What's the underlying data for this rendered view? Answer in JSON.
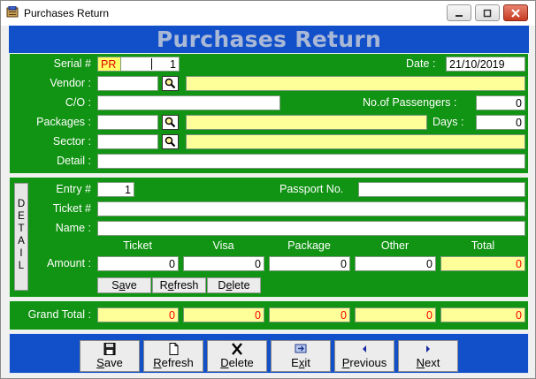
{
  "window": {
    "title": "Purchases Return"
  },
  "header": {
    "title": "Purchases Return"
  },
  "form": {
    "serial_label": "Serial #",
    "serial_prefix": "PR",
    "serial_number": "1",
    "date_label": "Date :",
    "date_value": "21/10/2019",
    "vendor_label": "Vendor :",
    "co_label": "C/O :",
    "passengers_label": "No.of Passengers :",
    "passengers_value": "0",
    "packages_label": "Packages :",
    "days_label": "Days :",
    "days_value": "0",
    "sector_label": "Sector :",
    "detail_label": "Detail :"
  },
  "detail": {
    "tab_letters": [
      "D",
      "E",
      "T",
      "A",
      "I",
      "L"
    ],
    "entry_label": "Entry #",
    "entry_value": "1",
    "passport_label": "Passport No.",
    "ticket_label": "Ticket #",
    "name_label": "Name :",
    "amount_label": "Amount :",
    "columns": [
      "Ticket",
      "Visa",
      "Package",
      "Other",
      "Total"
    ],
    "amounts": [
      "0",
      "0",
      "0",
      "0",
      "0"
    ],
    "save_prefix": "S",
    "save_ul": "a",
    "save_suffix": "ve",
    "refresh_prefix": "R",
    "refresh_ul": "e",
    "refresh_suffix": "fresh",
    "delete_prefix": "D",
    "delete_ul": "e",
    "delete_suffix": "lete"
  },
  "totals": {
    "label": "Grand Total :",
    "values": [
      "0",
      "0",
      "0",
      "0",
      "0"
    ]
  },
  "toolbar": {
    "save_ul": "S",
    "save_rest": "ave",
    "refresh_ul": "R",
    "refresh_rest": "efresh",
    "delete_ul": "D",
    "delete_rest": "elete",
    "exit_pre": "E",
    "exit_ul": "x",
    "exit_rest": "it",
    "previous_ul": "P",
    "previous_rest": "revious",
    "next_ul": "N",
    "next_rest": "ext"
  },
  "colors": {
    "panel_green": "#119313",
    "band_blue": "#1250c9",
    "highlight_yellow": "#ffff99",
    "total_red": "#ff0000"
  },
  "icons": [
    "purchases-app-icon",
    "minimize-icon",
    "maximize-icon",
    "close-icon",
    "search-icon",
    "floppy-disk-icon",
    "page-icon",
    "x-icon",
    "exit-icon",
    "arrow-left-icon",
    "arrow-right-icon"
  ]
}
